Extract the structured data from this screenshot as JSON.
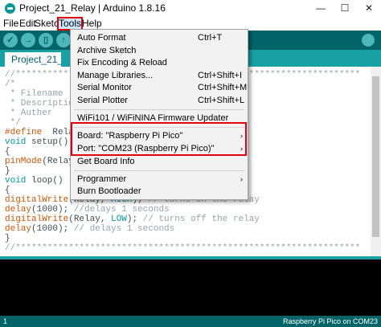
{
  "window": {
    "title": "Project_21_Relay | Arduino 1.8.16",
    "controls": {
      "minimize": "—",
      "maximize": "☐",
      "close": "✕"
    }
  },
  "menubar": {
    "items": [
      {
        "label": "File"
      },
      {
        "label": "Edit"
      },
      {
        "label": "Sketch"
      },
      {
        "label": "Tools"
      },
      {
        "label": "Help"
      }
    ]
  },
  "tab": {
    "label": "Project_21_Relay"
  },
  "tools_menu": {
    "items": [
      {
        "label": "Auto Format",
        "shortcut": "Ctrl+T"
      },
      {
        "label": "Archive Sketch",
        "shortcut": ""
      },
      {
        "label": "Fix Encoding & Reload",
        "shortcut": ""
      },
      {
        "label": "Manage Libraries...",
        "shortcut": "Ctrl+Shift+I"
      },
      {
        "label": "Serial Monitor",
        "shortcut": "Ctrl+Shift+M"
      },
      {
        "label": "Serial Plotter",
        "shortcut": "Ctrl+Shift+L"
      },
      {
        "label": "WiFi101 / WiFiNINA Firmware Updater",
        "shortcut": ""
      },
      {
        "label": "Board: \"Raspberry Pi Pico\"",
        "arrow": "›"
      },
      {
        "label": "Port: \"COM23 (Raspberry Pi Pico)\"",
        "arrow": "›"
      },
      {
        "label": "Get Board Info",
        "shortcut": ""
      },
      {
        "label": "Programmer",
        "arrow": "›"
      },
      {
        "label": "Burn Bootloader",
        "shortcut": ""
      }
    ]
  },
  "code": {
    "l1": "//*****************************************************************",
    "l2": "/*",
    "l3": " * Filename",
    "l4": " * Descriptio",
    "l5": " * Auther",
    "l6": " */",
    "l7a": "#define",
    "l7b": "  Rela",
    "l8a": "void",
    "l8b": " setup()",
    "l9": "{",
    "l10a": "pinMode",
    "l10b": "(Relay",
    "l11": "}",
    "l12a": "void",
    "l12b": " loop()",
    "l13": "{",
    "l14a": "digitalWrite",
    "l14b": "(Relay, ",
    "l14c": "HIGH",
    "l14d": "); ",
    "l14e": "// turns on the relay",
    "l15a": "delay",
    "l15b": "(1000); ",
    "l15c": "//delays 1 seconds",
    "l16a": "digitalWrite",
    "l16b": "(Relay, ",
    "l16c": "LOW",
    "l16d": "); ",
    "l16e": "// turns off the relay",
    "l17a": "delay",
    "l17b": "(1000); ",
    "l17c": "// delays 1 seconds",
    "l18": "}",
    "l19": "//*****************************************************************"
  },
  "status": {
    "line": "1",
    "board": "Raspberry Pi Pico on COM23"
  },
  "colors": {
    "toolbar": "#006468",
    "tabbar": "#17a1a5",
    "highlight": "#e0000f"
  }
}
